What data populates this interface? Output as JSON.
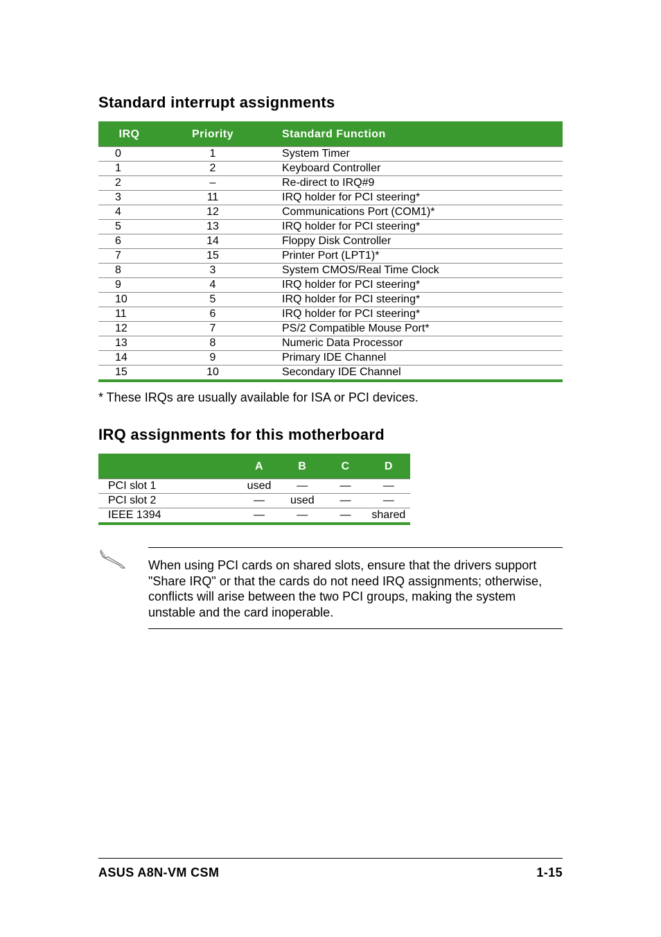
{
  "section1": {
    "title": "Standard interrupt assignments",
    "headers": [
      "IRQ",
      "Priority",
      "Standard Function"
    ],
    "rows": [
      {
        "irq": "0",
        "priority": "1",
        "func": "System Timer"
      },
      {
        "irq": "1",
        "priority": "2",
        "func": "Keyboard Controller"
      },
      {
        "irq": "2",
        "priority": "–",
        "func": "Re-direct to IRQ#9"
      },
      {
        "irq": "3",
        "priority": "11",
        "func": "IRQ holder for PCI steering*"
      },
      {
        "irq": "4",
        "priority": "12",
        "func": "Communications Port (COM1)*"
      },
      {
        "irq": "5",
        "priority": "13",
        "func": "IRQ holder for PCI steering*"
      },
      {
        "irq": "6",
        "priority": "14",
        "func": "Floppy Disk Controller"
      },
      {
        "irq": "7",
        "priority": "15",
        "func": "Printer Port (LPT1)*"
      },
      {
        "irq": "8",
        "priority": "3",
        "func": "System CMOS/Real Time Clock"
      },
      {
        "irq": "9",
        "priority": "4",
        "func": "IRQ holder for PCI steering*"
      },
      {
        "irq": "10",
        "priority": "5",
        "func": "IRQ holder for PCI steering*"
      },
      {
        "irq": "11",
        "priority": "6",
        "func": "IRQ holder for PCI steering*"
      },
      {
        "irq": "12",
        "priority": "7",
        "func": "PS/2 Compatible Mouse Port*"
      },
      {
        "irq": "13",
        "priority": "8",
        "func": "Numeric Data Processor"
      },
      {
        "irq": "14",
        "priority": "9",
        "func": "Primary IDE Channel"
      },
      {
        "irq": "15",
        "priority": "10",
        "func": "Secondary IDE Channel"
      }
    ],
    "footnote": "* These IRQs are usually available for ISA or PCI devices."
  },
  "section2": {
    "title": "IRQ assignments for this motherboard",
    "headers": [
      "",
      "A",
      "B",
      "C",
      "D"
    ],
    "rows": [
      {
        "label": "PCI slot 1",
        "a": "used",
        "b": "—",
        "c": "—",
        "d": "—"
      },
      {
        "label": "PCI slot 2",
        "a": "—",
        "b": "used",
        "c": "—",
        "d": "—"
      },
      {
        "label": "IEEE 1394",
        "a": "—",
        "b": "—",
        "c": "—",
        "d": "shared"
      }
    ]
  },
  "note": {
    "text": "When using PCI cards on shared slots, ensure that the drivers support \"Share IRQ\" or that the cards do not need IRQ assignments; otherwise, conflicts will arise between the two PCI groups, making the system unstable and the card inoperable."
  },
  "footer": {
    "left": "ASUS A8N-VM CSM",
    "right": "1-15"
  }
}
